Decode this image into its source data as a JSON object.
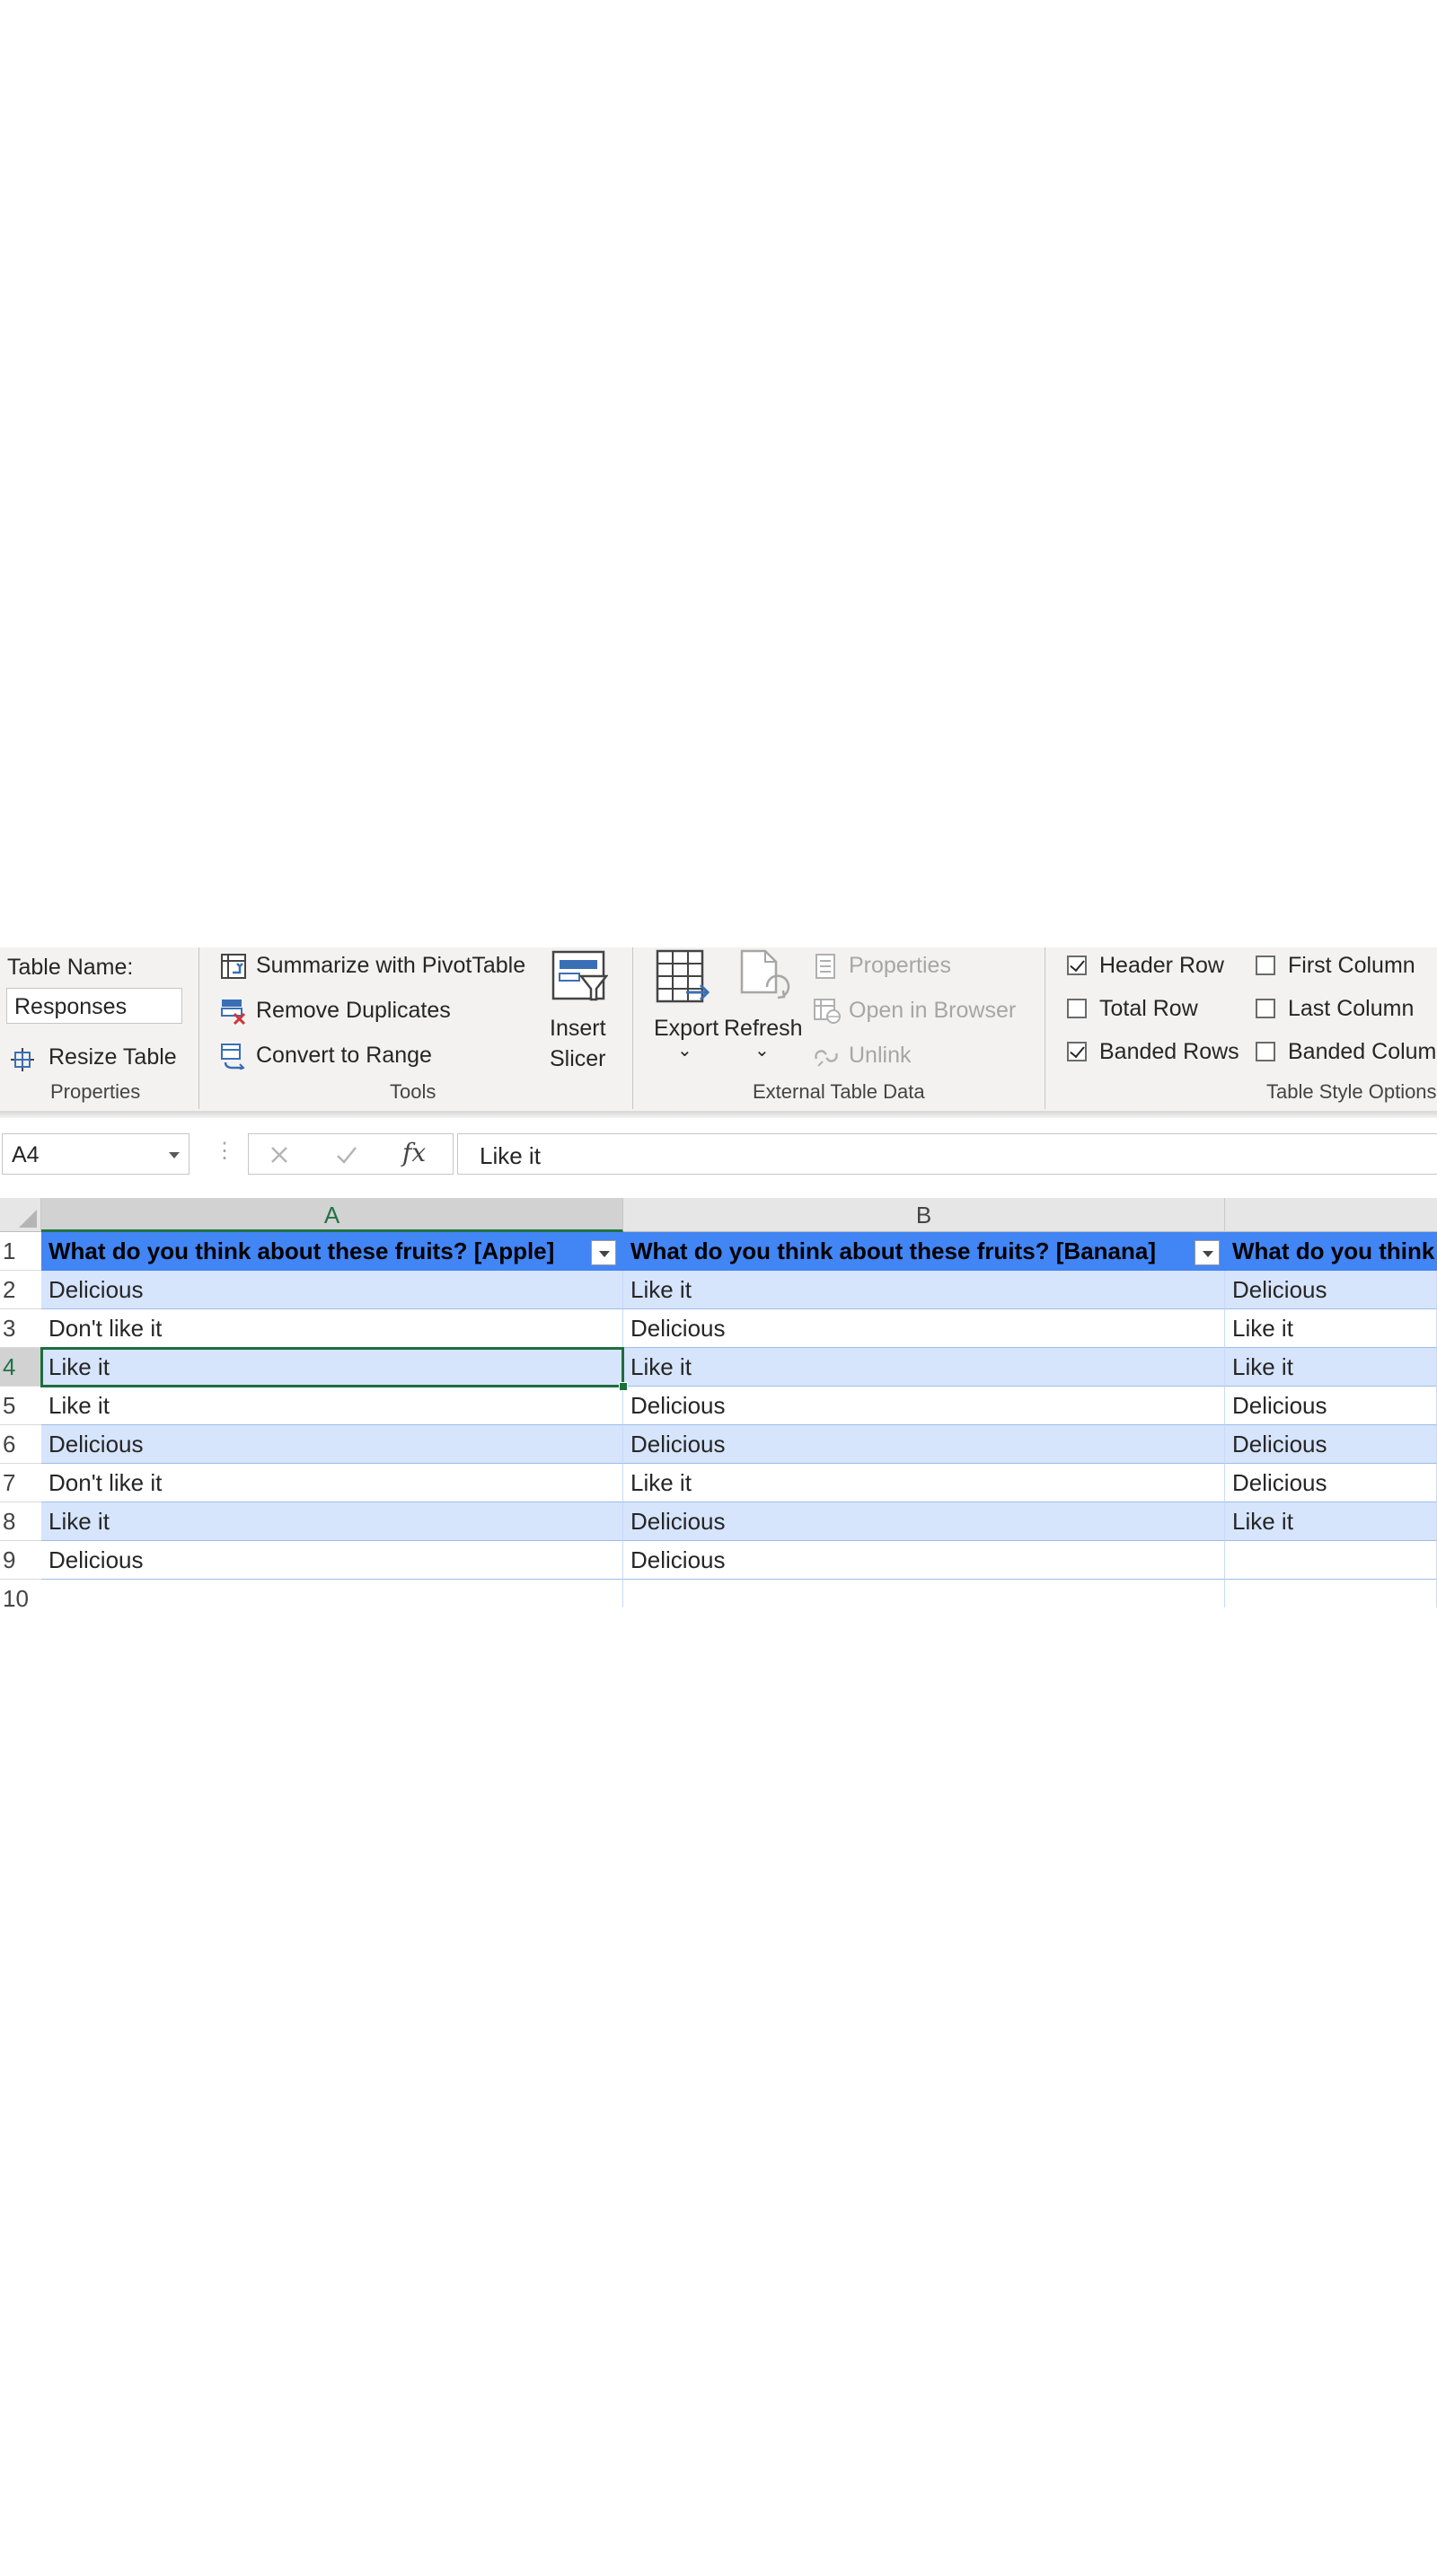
{
  "ribbon": {
    "properties": {
      "table_name_label": "Table Name:",
      "table_name_value": "Responses",
      "resize_table": "Resize Table",
      "group_label": "Properties"
    },
    "tools": {
      "summarize_pivot": "Summarize with PivotTable",
      "remove_duplicates": "Remove Duplicates",
      "convert_to_range": "Convert to Range",
      "insert_slicer_line1": "Insert",
      "insert_slicer_line2": "Slicer",
      "group_label": "Tools"
    },
    "external_data": {
      "export": "Export",
      "refresh": "Refresh",
      "properties": "Properties",
      "open_in_browser": "Open in Browser",
      "unlink": "Unlink",
      "group_label": "External Table Data"
    },
    "style_options": {
      "header_row": "Header Row",
      "total_row": "Total Row",
      "banded_rows": "Banded Rows",
      "first_column": "First Column",
      "last_column": "Last Column",
      "banded_columns": "Banded Column",
      "header_row_checked": true,
      "total_row_checked": false,
      "banded_rows_checked": true,
      "first_column_checked": false,
      "last_column_checked": false,
      "banded_columns_checked": false,
      "group_label": "Table Style Options"
    }
  },
  "formula_bar": {
    "name_box": "A4",
    "formula": "Like it"
  },
  "grid": {
    "columns": [
      "A",
      "B"
    ],
    "row_numbers": [
      "1",
      "2",
      "3",
      "4",
      "5",
      "6",
      "7",
      "8",
      "9",
      "10"
    ],
    "headers": [
      "What do you think about these fruits? [Apple]",
      "What do you think about these fruits? [Banana]",
      "What do you think"
    ],
    "rows": [
      [
        "Delicious",
        "Like it",
        "Delicious"
      ],
      [
        "Don't like it",
        "Delicious",
        "Like it"
      ],
      [
        "Like it",
        "Like it",
        "Like it"
      ],
      [
        "Like it",
        "Delicious",
        "Delicious"
      ],
      [
        "Delicious",
        "Delicious",
        "Delicious"
      ],
      [
        "Don't like it",
        "Like it",
        "Delicious"
      ],
      [
        "Like it",
        "Delicious",
        "Like it"
      ],
      [
        "Delicious",
        "Delicious",
        ""
      ],
      [
        "",
        "",
        ""
      ]
    ]
  }
}
